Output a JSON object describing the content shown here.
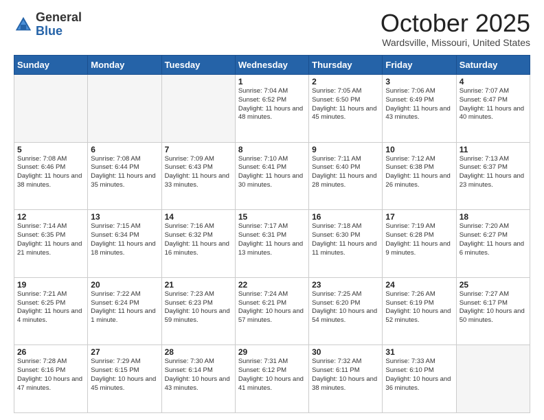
{
  "header": {
    "logo_general": "General",
    "logo_blue": "Blue",
    "month": "October 2025",
    "location": "Wardsville, Missouri, United States"
  },
  "days_of_week": [
    "Sunday",
    "Monday",
    "Tuesday",
    "Wednesday",
    "Thursday",
    "Friday",
    "Saturday"
  ],
  "weeks": [
    [
      {
        "day": "",
        "info": ""
      },
      {
        "day": "",
        "info": ""
      },
      {
        "day": "",
        "info": ""
      },
      {
        "day": "1",
        "info": "Sunrise: 7:04 AM\nSunset: 6:52 PM\nDaylight: 11 hours\nand 48 minutes."
      },
      {
        "day": "2",
        "info": "Sunrise: 7:05 AM\nSunset: 6:50 PM\nDaylight: 11 hours\nand 45 minutes."
      },
      {
        "day": "3",
        "info": "Sunrise: 7:06 AM\nSunset: 6:49 PM\nDaylight: 11 hours\nand 43 minutes."
      },
      {
        "day": "4",
        "info": "Sunrise: 7:07 AM\nSunset: 6:47 PM\nDaylight: 11 hours\nand 40 minutes."
      }
    ],
    [
      {
        "day": "5",
        "info": "Sunrise: 7:08 AM\nSunset: 6:46 PM\nDaylight: 11 hours\nand 38 minutes."
      },
      {
        "day": "6",
        "info": "Sunrise: 7:08 AM\nSunset: 6:44 PM\nDaylight: 11 hours\nand 35 minutes."
      },
      {
        "day": "7",
        "info": "Sunrise: 7:09 AM\nSunset: 6:43 PM\nDaylight: 11 hours\nand 33 minutes."
      },
      {
        "day": "8",
        "info": "Sunrise: 7:10 AM\nSunset: 6:41 PM\nDaylight: 11 hours\nand 30 minutes."
      },
      {
        "day": "9",
        "info": "Sunrise: 7:11 AM\nSunset: 6:40 PM\nDaylight: 11 hours\nand 28 minutes."
      },
      {
        "day": "10",
        "info": "Sunrise: 7:12 AM\nSunset: 6:38 PM\nDaylight: 11 hours\nand 26 minutes."
      },
      {
        "day": "11",
        "info": "Sunrise: 7:13 AM\nSunset: 6:37 PM\nDaylight: 11 hours\nand 23 minutes."
      }
    ],
    [
      {
        "day": "12",
        "info": "Sunrise: 7:14 AM\nSunset: 6:35 PM\nDaylight: 11 hours\nand 21 minutes."
      },
      {
        "day": "13",
        "info": "Sunrise: 7:15 AM\nSunset: 6:34 PM\nDaylight: 11 hours\nand 18 minutes."
      },
      {
        "day": "14",
        "info": "Sunrise: 7:16 AM\nSunset: 6:32 PM\nDaylight: 11 hours\nand 16 minutes."
      },
      {
        "day": "15",
        "info": "Sunrise: 7:17 AM\nSunset: 6:31 PM\nDaylight: 11 hours\nand 13 minutes."
      },
      {
        "day": "16",
        "info": "Sunrise: 7:18 AM\nSunset: 6:30 PM\nDaylight: 11 hours\nand 11 minutes."
      },
      {
        "day": "17",
        "info": "Sunrise: 7:19 AM\nSunset: 6:28 PM\nDaylight: 11 hours\nand 9 minutes."
      },
      {
        "day": "18",
        "info": "Sunrise: 7:20 AM\nSunset: 6:27 PM\nDaylight: 11 hours\nand 6 minutes."
      }
    ],
    [
      {
        "day": "19",
        "info": "Sunrise: 7:21 AM\nSunset: 6:25 PM\nDaylight: 11 hours\nand 4 minutes."
      },
      {
        "day": "20",
        "info": "Sunrise: 7:22 AM\nSunset: 6:24 PM\nDaylight: 11 hours\nand 1 minute."
      },
      {
        "day": "21",
        "info": "Sunrise: 7:23 AM\nSunset: 6:23 PM\nDaylight: 10 hours\nand 59 minutes."
      },
      {
        "day": "22",
        "info": "Sunrise: 7:24 AM\nSunset: 6:21 PM\nDaylight: 10 hours\nand 57 minutes."
      },
      {
        "day": "23",
        "info": "Sunrise: 7:25 AM\nSunset: 6:20 PM\nDaylight: 10 hours\nand 54 minutes."
      },
      {
        "day": "24",
        "info": "Sunrise: 7:26 AM\nSunset: 6:19 PM\nDaylight: 10 hours\nand 52 minutes."
      },
      {
        "day": "25",
        "info": "Sunrise: 7:27 AM\nSunset: 6:17 PM\nDaylight: 10 hours\nand 50 minutes."
      }
    ],
    [
      {
        "day": "26",
        "info": "Sunrise: 7:28 AM\nSunset: 6:16 PM\nDaylight: 10 hours\nand 47 minutes."
      },
      {
        "day": "27",
        "info": "Sunrise: 7:29 AM\nSunset: 6:15 PM\nDaylight: 10 hours\nand 45 minutes."
      },
      {
        "day": "28",
        "info": "Sunrise: 7:30 AM\nSunset: 6:14 PM\nDaylight: 10 hours\nand 43 minutes."
      },
      {
        "day": "29",
        "info": "Sunrise: 7:31 AM\nSunset: 6:12 PM\nDaylight: 10 hours\nand 41 minutes."
      },
      {
        "day": "30",
        "info": "Sunrise: 7:32 AM\nSunset: 6:11 PM\nDaylight: 10 hours\nand 38 minutes."
      },
      {
        "day": "31",
        "info": "Sunrise: 7:33 AM\nSunset: 6:10 PM\nDaylight: 10 hours\nand 36 minutes."
      },
      {
        "day": "",
        "info": ""
      }
    ]
  ]
}
